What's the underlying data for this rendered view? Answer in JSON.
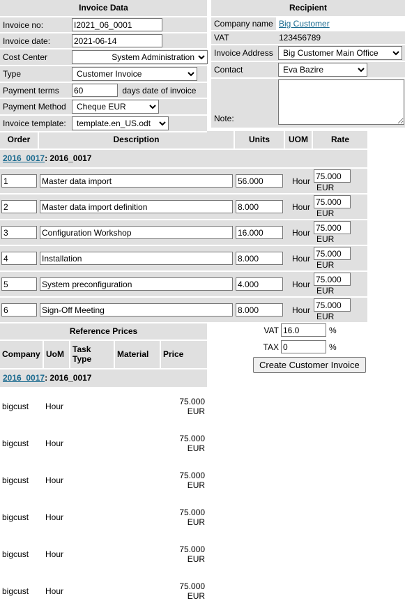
{
  "invoice_data": {
    "title": "Invoice Data",
    "rows": {
      "invoice_no_label": "Invoice no:",
      "invoice_no_value": "I2021_06_0001",
      "invoice_date_label": "Invoice date:",
      "invoice_date_value": "2021-06-14",
      "cost_center_label": "Cost Center",
      "cost_center_value": "System Administration",
      "type_label": "Type",
      "type_value": "Customer Invoice",
      "payment_terms_label": "Payment terms",
      "payment_terms_value": "60",
      "payment_terms_suffix": "days date of invoice",
      "payment_method_label": "Payment Method",
      "payment_method_value": "Cheque EUR",
      "invoice_template_label": "Invoice template:",
      "invoice_template_value": "template.en_US.odt"
    }
  },
  "recipient": {
    "title": "Recipient",
    "company_name_label": "Company name",
    "company_name_value": "Big Customer",
    "vat_label": "VAT",
    "vat_value": "123456789",
    "invoice_address_label": "Invoice Address",
    "invoice_address_value": "Big Customer Main Office",
    "contact_label": "Contact",
    "contact_value": "Eva Bazire",
    "note_label": "Note:",
    "note_value": ""
  },
  "items": {
    "headers": [
      "Order",
      "Description",
      "Units",
      "UOM",
      "Rate"
    ],
    "group_link": "2016_0017",
    "group_suffix": ": 2016_0017",
    "rows": [
      {
        "order": "1",
        "description": "Master data import",
        "units": "56.000",
        "uom": "Hour",
        "rate": "75.000",
        "currency": "EUR"
      },
      {
        "order": "2",
        "description": "Master data import definition",
        "units": "8.000",
        "uom": "Hour",
        "rate": "75.000",
        "currency": "EUR"
      },
      {
        "order": "3",
        "description": "Configuration Workshop",
        "units": "16.000",
        "uom": "Hour",
        "rate": "75.000",
        "currency": "EUR"
      },
      {
        "order": "4",
        "description": "Installation",
        "units": "8.000",
        "uom": "Hour",
        "rate": "75.000",
        "currency": "EUR"
      },
      {
        "order": "5",
        "description": "System preconfiguration",
        "units": "4.000",
        "uom": "Hour",
        "rate": "75.000",
        "currency": "EUR"
      },
      {
        "order": "6",
        "description": "Sign-Off Meeting",
        "units": "8.000",
        "uom": "Hour",
        "rate": "75.000",
        "currency": "EUR"
      }
    ]
  },
  "reference_prices": {
    "title": "Reference Prices",
    "headers": [
      "Company",
      "UoM",
      "Task Type",
      "Material",
      "Price"
    ],
    "group_link": "2016_0017",
    "group_suffix": ": 2016_0017",
    "rows": [
      {
        "company": "bigcust",
        "uom": "Hour",
        "task_type": "",
        "material": "",
        "price": "75.000 EUR"
      },
      {
        "company": "bigcust",
        "uom": "Hour",
        "task_type": "",
        "material": "",
        "price": "75.000 EUR"
      },
      {
        "company": "bigcust",
        "uom": "Hour",
        "task_type": "",
        "material": "",
        "price": "75.000 EUR"
      },
      {
        "company": "bigcust",
        "uom": "Hour",
        "task_type": "",
        "material": "",
        "price": "75.000 EUR"
      },
      {
        "company": "bigcust",
        "uom": "Hour",
        "task_type": "",
        "material": "",
        "price": "75.000 EUR"
      },
      {
        "company": "bigcust",
        "uom": "Hour",
        "task_type": "",
        "material": "",
        "price": "75.000 EUR"
      }
    ]
  },
  "totals": {
    "vat_label": "VAT",
    "vat_value": "16.0",
    "vat_unit": "%",
    "tax_label": "TAX",
    "tax_value": "0",
    "tax_unit": "%",
    "create_button": "Create Customer Invoice"
  },
  "colors": {
    "panel_header_bg": "#e0e0e0",
    "link": "#1a6a8f",
    "page_bg": "#ffffff"
  }
}
